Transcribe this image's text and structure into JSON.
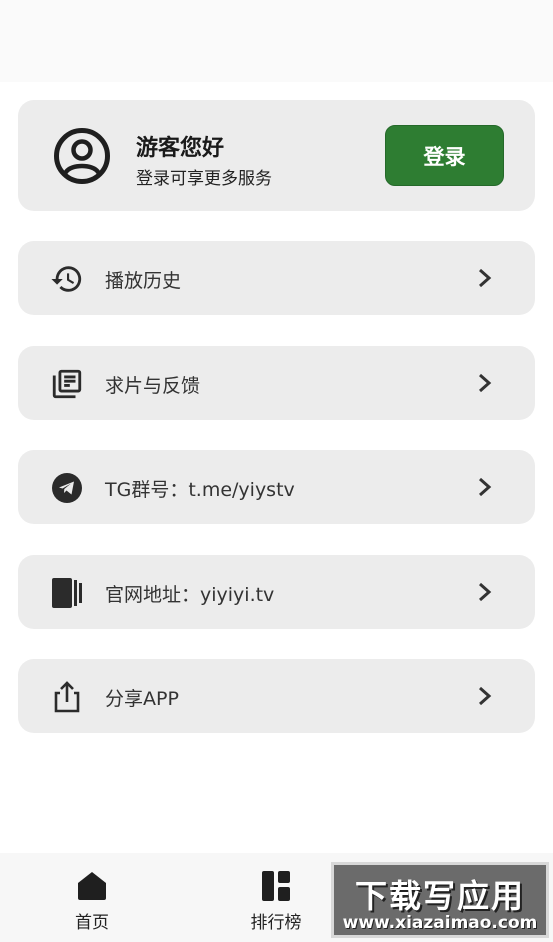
{
  "profile": {
    "greeting": "游客您好",
    "subtitle": "登录可享更多服务",
    "login_label": "登录"
  },
  "menu": [
    {
      "icon": "history-icon",
      "label": "播放历史"
    },
    {
      "icon": "feedback-list-icon",
      "label": "求片与反馈"
    },
    {
      "icon": "telegram-icon",
      "label": "TG群号：t.me/yiystv"
    },
    {
      "icon": "website-icon",
      "label": "官网地址：yiyiyi.tv"
    },
    {
      "icon": "share-icon",
      "label": "分享APP"
    }
  ],
  "tabbar": {
    "home_label": "首页",
    "ranking_label": "排行榜"
  },
  "watermark": {
    "title": "下载写应用",
    "url": "www.xiazaimao.com"
  },
  "colors": {
    "accent": "#2e7d32",
    "card_bg": "#ececec"
  }
}
